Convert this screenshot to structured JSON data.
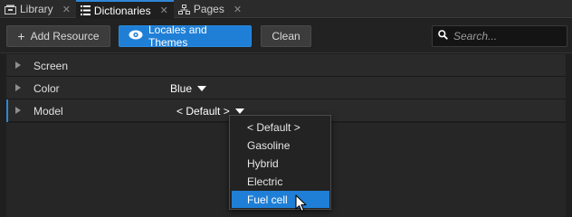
{
  "tabs": [
    {
      "label": "Library",
      "icon": "library-icon",
      "active": false
    },
    {
      "label": "Dictionaries",
      "icon": "dictionaries-icon",
      "active": true
    },
    {
      "label": "Pages",
      "icon": "pages-icon",
      "active": false
    }
  ],
  "toolbar": {
    "add_resource": "Add Resource",
    "add_symbol": "+",
    "locales_and_themes": "Locales and Themes",
    "clean": "Clean",
    "search_placeholder": "Search..."
  },
  "rows": [
    {
      "label": "Screen",
      "value": ""
    },
    {
      "label": "Color",
      "value": "Blue"
    },
    {
      "label": "Model",
      "value": "< Default >"
    }
  ],
  "dropdown": {
    "options": [
      "< Default >",
      "Gasoline",
      "Hybrid",
      "Electric",
      "Fuel cell"
    ],
    "highlighted": "Fuel cell"
  },
  "colors": {
    "accent": "#1f7fd6",
    "background": "#1f1f1f",
    "row": "#2a2a2a"
  }
}
